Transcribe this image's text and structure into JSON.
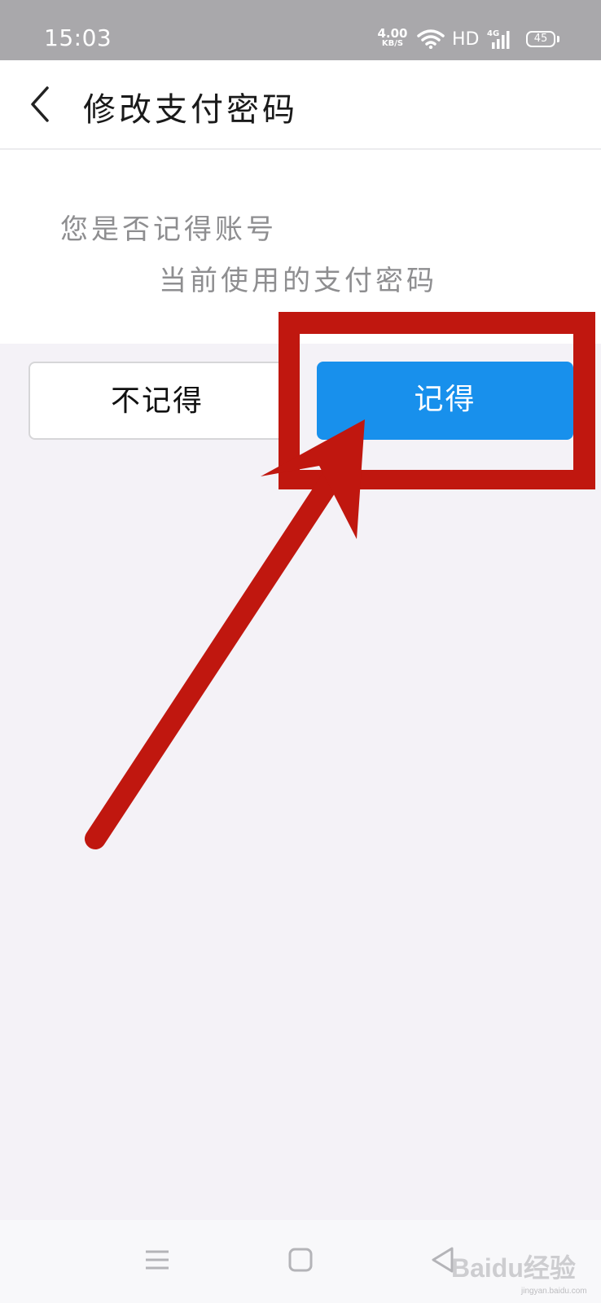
{
  "status_bar": {
    "time": "15:03",
    "net_speed_value": "4.00",
    "net_speed_unit": "KB/S",
    "hd_label": "HD",
    "network_type": "4G",
    "battery": "45"
  },
  "header": {
    "title": "修改支付密码",
    "back_icon": "chevron-left-icon"
  },
  "question": {
    "line1": "您是否记得账号",
    "line2": "当前使用的支付密码"
  },
  "buttons": {
    "forgot_label": "不记得",
    "remember_label": "记得"
  },
  "colors": {
    "primary_button": "#1890ec",
    "annotation_red": "#c0170f",
    "page_background": "#f4f2f7"
  },
  "nav_bar": {
    "icons": [
      "menu-icon",
      "home-square-icon",
      "back-triangle-icon"
    ]
  },
  "watermark": {
    "text": "Baidu经验",
    "sub": "jingyan.baidu.com"
  }
}
